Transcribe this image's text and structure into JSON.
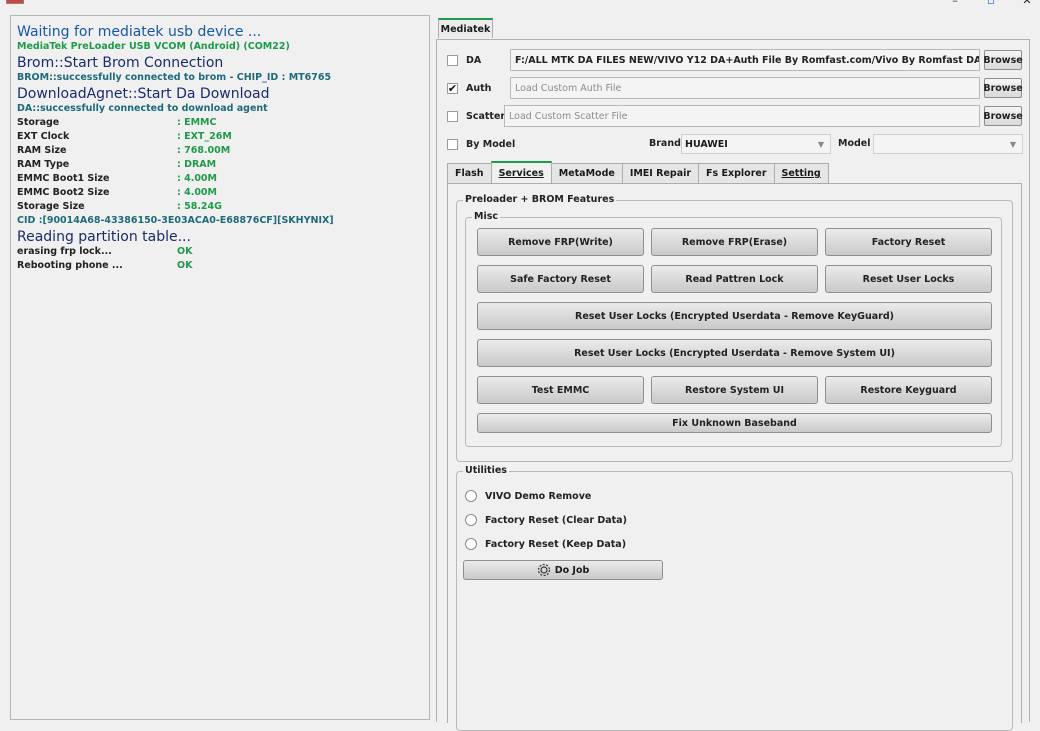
{
  "log": {
    "lines": [
      {
        "text": "Waiting for mediatek usb device ...",
        "cls": "log-big c-blue"
      },
      {
        "text": "MediaTek PreLoader USB VCOM (Android) (COM22)",
        "cls": "b c-green"
      },
      {
        "text": "Brom::Start Brom Connection",
        "cls": "log-big c-navy"
      },
      {
        "text": "BROM::successfully connected to brom - CHIP_ID : MT6765",
        "cls": "b c-teal"
      },
      {
        "text": "DownloadAgnet::Start Da Download",
        "cls": "log-big c-navy"
      },
      {
        "text": "DA::successfully connected to download agent",
        "cls": "b c-teal"
      }
    ],
    "info": [
      {
        "key": "Storage",
        "value": ": EMMC"
      },
      {
        "key": "EXT Clock",
        "value": ": EXT_26M"
      },
      {
        "key": "RAM Size",
        "value": ": 768.00M"
      },
      {
        "key": "RAM Type",
        "value": ": DRAM"
      },
      {
        "key": "EMMC Boot1 Size",
        "value": ": 4.00M"
      },
      {
        "key": "EMMC Boot2 Size",
        "value": ": 4.00M"
      },
      {
        "key": "Storage Size",
        "value": ": 58.24G"
      }
    ],
    "cid": "CID :[90014A68-43386150-3E03ACA0-E68876CF][SKHYNIX]",
    "reading": "Reading partition table...",
    "steps": [
      {
        "label": "erasing frp lock...",
        "status": "OK"
      },
      {
        "label": "Rebooting phone ...",
        "status": "OK"
      }
    ]
  },
  "main_tab": "Mediatek",
  "files": {
    "da_label": "DA",
    "da_value": "F:/ALL  MTK DA FILES NEW/VIVO Y12 DA+Auth File By Romfast.com/Vivo By Romfast DA.bin",
    "auth_label": "Auth",
    "auth_placeholder": "Load Custom Auth File",
    "scatter_label": "Scatter",
    "scatter_placeholder": "Load Custom Scatter File",
    "browse": "Browse",
    "bymodel_label": "By Model",
    "brand_label": "Brand",
    "brand_value": "HUAWEI",
    "model_label": "Model",
    "model_value": ""
  },
  "subtabs": [
    "Flash",
    "Services",
    "MetaMode",
    "IMEI Repair",
    "Fs Explorer",
    "Setting"
  ],
  "services": {
    "group_title": "Preloader + BROM Features",
    "misc_title": "Misc",
    "buttons": {
      "remove_frp_write": "Remove FRP(Write)",
      "remove_frp_erase": "Remove FRP(Erase)",
      "factory_reset": "Factory Reset",
      "safe_factory_reset": "Safe Factory Reset",
      "read_pattern_lock": "Read Pattren Lock",
      "reset_user_locks": "Reset User Locks",
      "reset_user_locks_keyguard": "Reset User Locks (Encrypted Userdata - Remove KeyGuard)",
      "reset_user_locks_systemui": "Reset User Locks (Encrypted Userdata - Remove System UI)",
      "test_emmc": "Test EMMC",
      "restore_system_ui": "Restore System UI",
      "restore_keyguard": "Restore Keyguard",
      "fix_unknown_baseband": "Fix Unknown Baseband"
    },
    "utilities_title": "Utilities",
    "radios": [
      "VIVO Demo Remove",
      "Factory Reset (Clear Data)",
      "Factory Reset (Keep Data)"
    ],
    "do_job": "Do Job"
  },
  "colors": {
    "accent": "#1f9a4a",
    "log_blue": "#1a56a8",
    "log_navy": "#1b2a6b"
  }
}
